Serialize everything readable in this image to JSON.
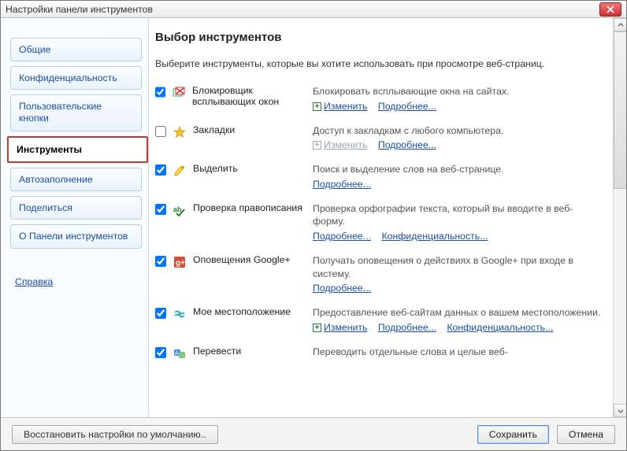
{
  "window": {
    "title": "Настройки панели инструментов"
  },
  "sidebar": {
    "items": [
      {
        "label": "Общие"
      },
      {
        "label": "Конфиденциальность"
      },
      {
        "label": "Пользовательские кнопки"
      },
      {
        "label": "Инструменты"
      },
      {
        "label": "Автозаполнение"
      },
      {
        "label": "Поделиться"
      },
      {
        "label": "О Панели инструментов"
      }
    ],
    "help": "Справка"
  },
  "main": {
    "heading": "Выбор инструментов",
    "instruction": "Выберите инструменты, которые вы хотите использовать при просмотре веб-страниц.",
    "modify": "Изменить",
    "more": "Подробнее...",
    "privacy": "Конфиденциальность...",
    "tools": [
      {
        "name": "Блокировщик всплывающих окон",
        "desc": "Блокировать всплывающие окна на сайтах.",
        "checked": true,
        "modify": true,
        "more": true
      },
      {
        "name": "Закладки",
        "desc": "Доступ к закладкам с любого компьютера.",
        "checked": false,
        "modify": true,
        "modify_disabled": true,
        "more": true
      },
      {
        "name": "Выделить",
        "desc": "Поиск и выделение слов на веб-странице.",
        "checked": true,
        "more": true
      },
      {
        "name": "Проверка правописания",
        "desc": "Проверка орфографии текста, который вы вводите в веб-форму.",
        "checked": true,
        "more": true,
        "privacy": true
      },
      {
        "name": "Оповещения Google+",
        "desc": "Получать оповещения о действиях в Google+ при входе в систему.",
        "checked": true,
        "more": true
      },
      {
        "name": "Мое местоположение",
        "desc": "Предоставление веб-сайтам данных о вашем местоположении.",
        "checked": true,
        "modify": true,
        "more": true,
        "privacy": true
      },
      {
        "name": "Перевести",
        "desc": "Переводить отдельные слова и целые веб-",
        "checked": true
      }
    ]
  },
  "footer": {
    "reset": "Восстановить настройки по умолчанию..",
    "save": "Сохранить",
    "cancel": "Отмена"
  }
}
